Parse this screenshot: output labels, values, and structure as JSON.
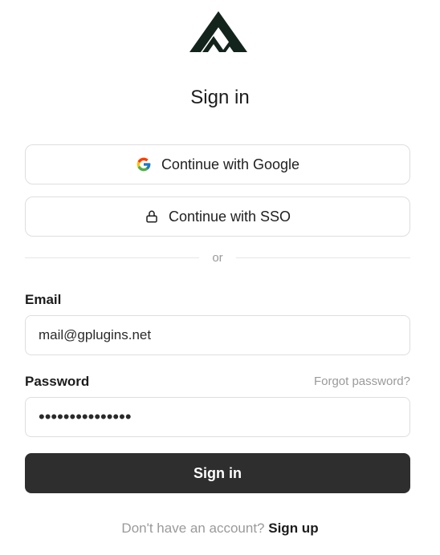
{
  "header": {
    "logo_icon": "mountain-logo-icon",
    "title": "Sign in"
  },
  "oauth": {
    "google_label": "Continue with Google",
    "google_icon": "google-icon",
    "sso_label": "Continue with SSO",
    "sso_icon": "lock-icon"
  },
  "divider": {
    "text": "or"
  },
  "form": {
    "email_label": "Email",
    "email_value": "mail@gplugins.net",
    "password_label": "Password",
    "forgot_label": "Forgot password?",
    "password_masked": "•••••••••••••••",
    "submit_label": "Sign in"
  },
  "footer": {
    "prompt": "Don't have an account?",
    "signup_label": "Sign up"
  },
  "colors": {
    "primary_button": "#2e2e2e",
    "border": "#dedede",
    "muted_text": "#9a9a9a"
  }
}
